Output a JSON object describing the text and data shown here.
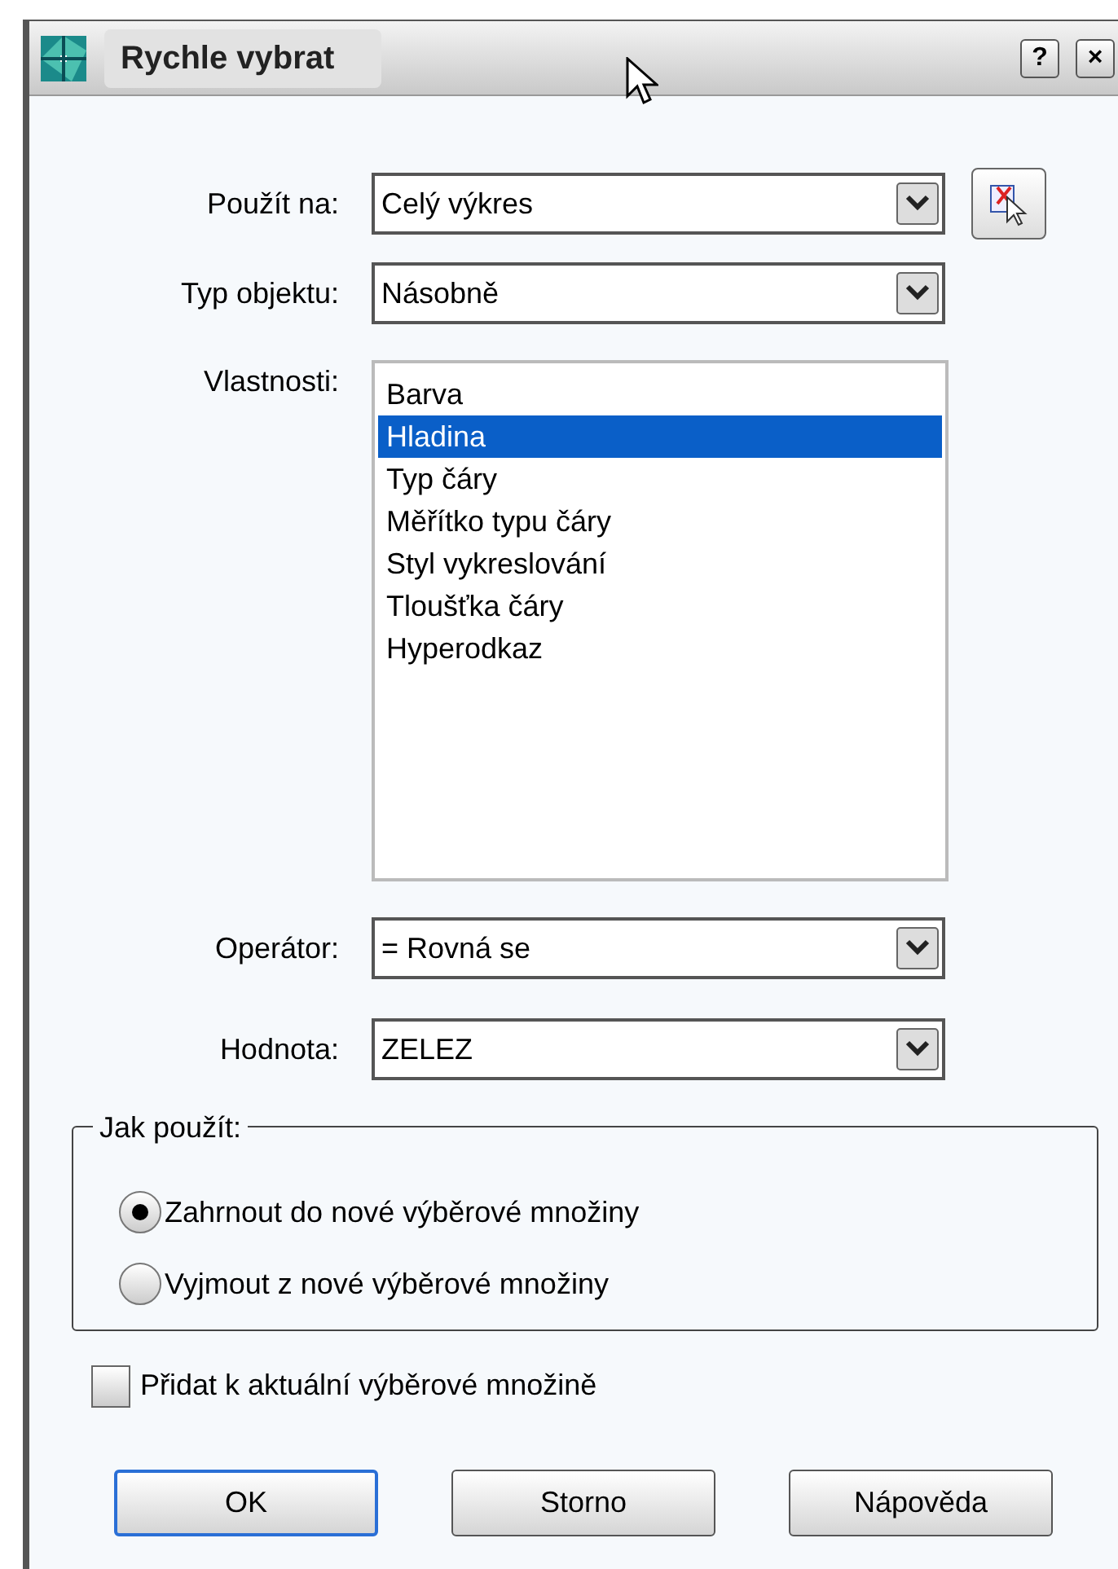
{
  "window": {
    "title": "Rychle vybrat",
    "buttons": [
      "?",
      "×"
    ]
  },
  "fields": [
    {
      "label": "Použít na:",
      "value": "Celý výkres",
      "kind": "dropdown",
      "pick_button": true
    },
    {
      "label": "Typ objektu:",
      "value": "Násobně",
      "kind": "dropdown",
      "pick_button": false
    }
  ],
  "properties": {
    "label": "Vlastnosti:",
    "items": [
      {
        "text": "Barva",
        "selected": false
      },
      {
        "text": "Hladina",
        "selected": true
      },
      {
        "text": "Typ čáry",
        "selected": false
      },
      {
        "text": "Měřítko typu čáry",
        "selected": false
      },
      {
        "text": "Styl vykreslování",
        "selected": false
      },
      {
        "text": "Tloušťka čáry",
        "selected": false
      },
      {
        "text": "Hyperodkaz",
        "selected": false
      }
    ]
  },
  "conditions": [
    {
      "label": "Operátor:",
      "value": "= Rovná se"
    },
    {
      "label": "Hodnota:",
      "value": "ZELEZ"
    }
  ],
  "apply": {
    "legend": "Jak použít:",
    "options": [
      {
        "label": "Zahrnout do nové výběrové množiny",
        "selected": true
      },
      {
        "label": "Vyjmout z nové výběrové množiny",
        "selected": false
      }
    ]
  },
  "append": {
    "label": "Přidat k aktuální výběrové množině",
    "checked": false
  },
  "buttons": [
    {
      "label": "OK",
      "default": true
    },
    {
      "label": "Storno",
      "default": false
    },
    {
      "label": "Nápověda",
      "default": false
    }
  ]
}
